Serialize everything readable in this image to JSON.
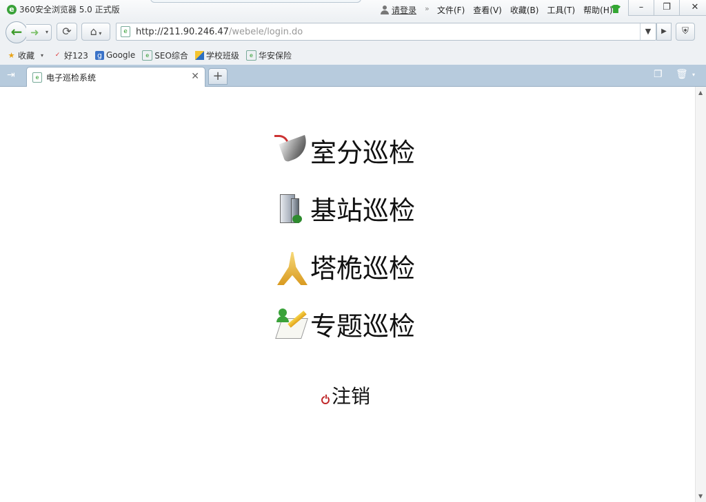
{
  "window": {
    "title": "360安全浏览器 5.0 正式版",
    "login_label": "请登录",
    "menu": [
      "文件(F)",
      "查看(V)",
      "收藏(B)",
      "工具(T)",
      "帮助(H)"
    ],
    "controls": {
      "minimize": "–",
      "restore": "❐",
      "close": "✕"
    }
  },
  "nav": {
    "url_host": "http://211.90.246.47",
    "url_path": "/webele/login.do"
  },
  "bookmarks": {
    "favorites_label": "收藏",
    "items": [
      "好123",
      "Google",
      "SEO综合",
      "学校班级",
      "华安保险"
    ]
  },
  "tab": {
    "title": "电子巡检系统"
  },
  "page": {
    "entries": [
      {
        "label": "室分巡检",
        "icon": "satellite-dish-icon"
      },
      {
        "label": "基站巡检",
        "icon": "building-icon"
      },
      {
        "label": "塔桅巡检",
        "icon": "tower-icon"
      },
      {
        "label": "专题巡检",
        "icon": "notebook-pencil-icon"
      }
    ],
    "logout_label": "注销"
  },
  "colors": {
    "tab_strip": "#b7cbdd",
    "chrome": "#eef1f4",
    "power_red": "#c0282a",
    "brand_green": "#3aa23a"
  }
}
